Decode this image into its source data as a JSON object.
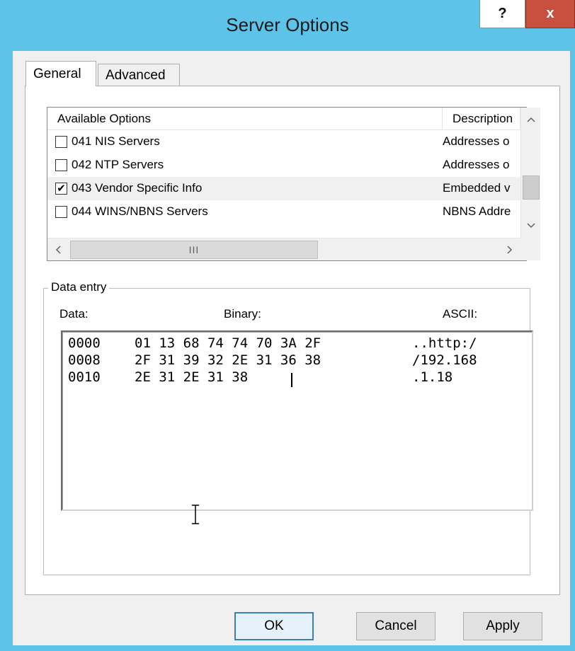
{
  "window": {
    "title": "Server Options",
    "help_label": "?",
    "close_label": "x"
  },
  "tabs": [
    {
      "label": "General",
      "selected": true
    },
    {
      "label": "Advanced",
      "selected": false
    }
  ],
  "options_list": {
    "columns": [
      "Available Options",
      "Description"
    ],
    "rows": [
      {
        "name": "041 NIS Servers",
        "description": "Addresses o",
        "checked": false
      },
      {
        "name": "042 NTP Servers",
        "description": "Addresses o",
        "checked": false
      },
      {
        "name": "043 Vendor Specific Info",
        "description": "Embedded v",
        "checked": true
      },
      {
        "name": "044 WINS/NBNS Servers",
        "description": "NBNS Addre",
        "checked": false
      }
    ],
    "scroll_up": "^",
    "scroll_down": "v",
    "scroll_left": "<",
    "scroll_right": ">",
    "hscroll_thumb_grip": "III"
  },
  "data_entry": {
    "group_label": "Data entry",
    "col_data": "Data:",
    "col_binary": "Binary:",
    "col_ascii": "ASCII:",
    "lines": [
      {
        "offset": "0000",
        "hex": "01 13 68 74 74 70 3A 2F",
        "ascii": "..http:/"
      },
      {
        "offset": "0008",
        "hex": "2F 31 39 32 2E 31 36 38",
        "ascii": "/192.168"
      },
      {
        "offset": "0010",
        "hex": "2E 31 2E 31 38",
        "ascii": ".1.18"
      }
    ]
  },
  "buttons": {
    "ok": "OK",
    "cancel": "Cancel",
    "apply": "Apply"
  },
  "colors": {
    "titlebar": "#5ec3e8",
    "close_button": "#c7503f",
    "default_button_border": "#3c7fb1"
  }
}
